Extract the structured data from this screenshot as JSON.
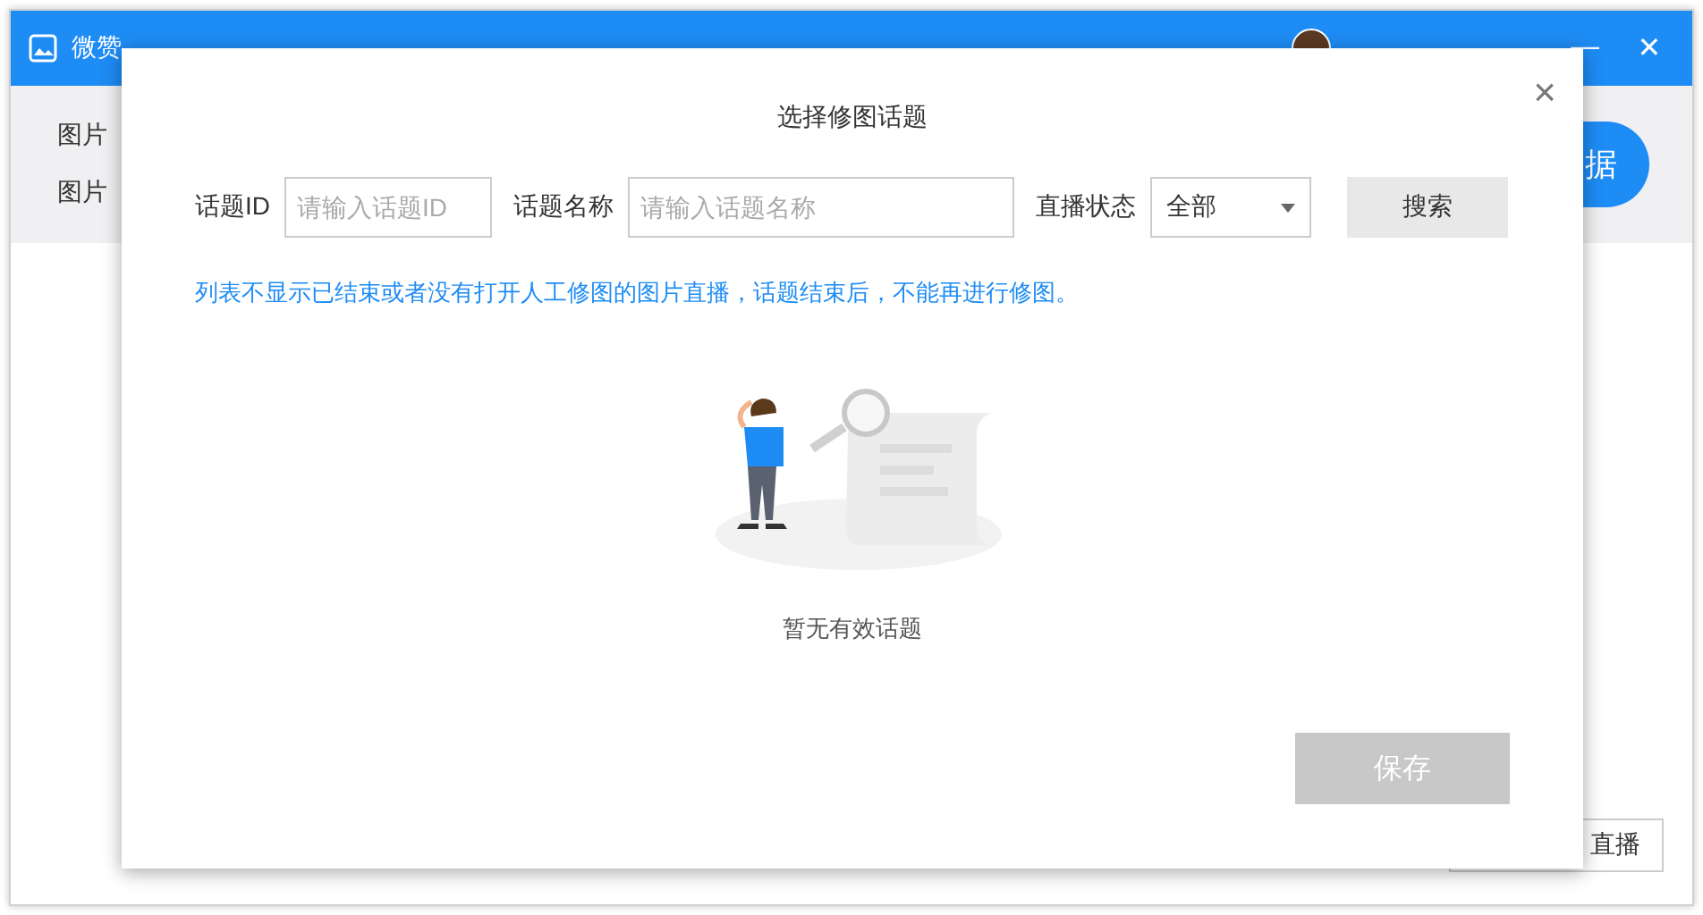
{
  "window": {
    "title": "微赞",
    "controls": [
      "—",
      "✕"
    ]
  },
  "background": {
    "menu_items": [
      {
        "label": "图片"
      },
      {
        "label": "图片"
      }
    ],
    "round_button": "据",
    "bottom_button": "直播"
  },
  "dialog": {
    "title": "选择修图话题",
    "close": "×",
    "filters": [
      {
        "kind": "input",
        "label": "话题ID",
        "placeholder": "请输入话题ID"
      },
      {
        "kind": "input",
        "label": "话题名称",
        "placeholder": "请输入话题名称"
      },
      {
        "kind": "select",
        "label": "直播状态",
        "value": "全部"
      }
    ],
    "search_button": "搜索",
    "notice": "列表不显示已结束或者没有打开人工修图的图片直播，话题结束后，不能再进行修图。",
    "empty_text": "暂无有效话题",
    "save_button": {
      "label": "保存",
      "disabled": true
    }
  }
}
